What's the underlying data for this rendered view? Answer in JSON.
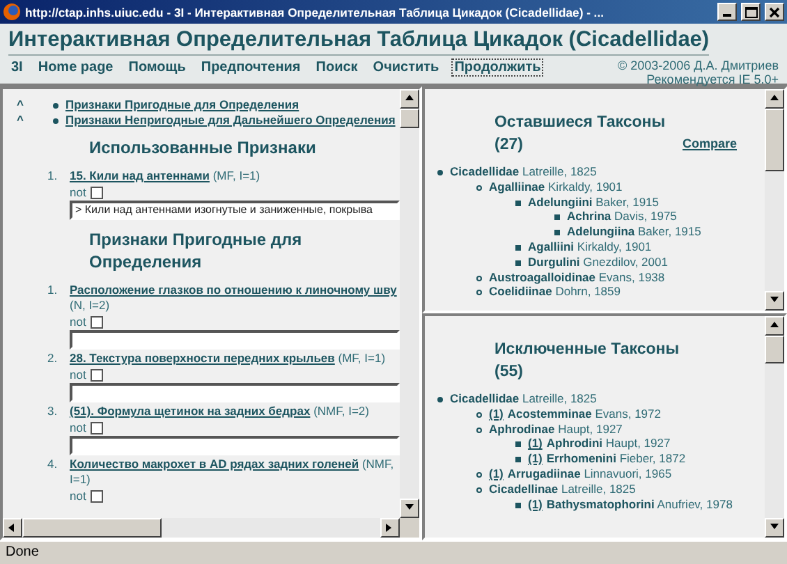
{
  "window": {
    "title": "http://ctap.inhs.uiuc.edu - 3I - Интерактивная Определительная Таблица Цикадок (Cicadellidae) - ..."
  },
  "header": {
    "title": "Интерактивная Определительная Таблица Цикадок (Cicadellidae)",
    "nav": [
      {
        "label": "3I",
        "selected": false
      },
      {
        "label": "Home page",
        "selected": false
      },
      {
        "label": "Помощь",
        "selected": false
      },
      {
        "label": "Предпочтения",
        "selected": false
      },
      {
        "label": "Поиск",
        "selected": false
      },
      {
        "label": "Очистить",
        "selected": false
      },
      {
        "label": "Продолжить",
        "selected": true
      }
    ],
    "copyright": "© 2003-2006 Д.А. Дмитриев",
    "recommendation": "Рекомендуется IE 5.0+"
  },
  "characters": {
    "jump_links": [
      {
        "marker": "^",
        "label": "Признаки Пригодные для Определения"
      },
      {
        "marker": "^",
        "label": "Признаки Непригодные для Дальнейшего Определения"
      }
    ],
    "used_heading": "Использованные Признаки",
    "used": [
      {
        "number": "1.",
        "label": "15. Кили над антеннами",
        "meta": "(MF, I=1)",
        "not_label": "not",
        "negated": false,
        "value": "> Кили над антеннами изогнутые и заниженные, покрыва"
      }
    ],
    "usable_heading": "Признаки Пригодные для Определения",
    "usable": [
      {
        "number": "1.",
        "label": "Расположение глазков по отношению к линочному шву",
        "meta": "(N, I=2)",
        "not_label": "not",
        "negated": false
      },
      {
        "number": "2.",
        "label": "28. Текстура поверхности передних крыльев",
        "meta": "(MF, I=1)",
        "not_label": "not",
        "negated": false
      },
      {
        "number": "3.",
        "label": "(51). Формула щетинок на задних бедрах",
        "meta": "(NMF, I=2)",
        "not_label": "not",
        "negated": false
      },
      {
        "number": "4.",
        "label": "Количество макрохет в AD рядах задних голеней",
        "meta": "(NMF, I=1)",
        "not_label": "not",
        "negated": false
      }
    ]
  },
  "remaining_taxa": {
    "heading": "Оставшиеся Таксоны (27)",
    "compare": "Compare",
    "tree": [
      {
        "name": "Cicadellidae",
        "author": "Latreille, 1825",
        "children": [
          {
            "name": "Agalliinae",
            "author": "Kirkaldy, 1901",
            "children": [
              {
                "name": "Adelungiini",
                "author": "Baker, 1915",
                "children": [
                  {
                    "name": "Achrina",
                    "author": "Davis, 1975"
                  },
                  {
                    "name": "Adelungiina",
                    "author": "Baker, 1915"
                  }
                ]
              },
              {
                "name": "Agalliini",
                "author": "Kirkaldy, 1901"
              },
              {
                "name": "Durgulini",
                "author": "Gnezdilov, 2001"
              }
            ]
          },
          {
            "name": "Austroagalloidinae",
            "author": "Evans, 1938"
          },
          {
            "name": "Coelidiinae",
            "author": "Dohrn, 1859"
          }
        ]
      }
    ]
  },
  "excluded_taxa": {
    "heading": "Исключенные Таксоны (55)",
    "tree": [
      {
        "name": "Cicadellidae",
        "author": "Latreille, 1825",
        "children": [
          {
            "count": "(1)",
            "name": "Acostemminae",
            "author": "Evans, 1972"
          },
          {
            "name": "Aphrodinae",
            "author": "Haupt, 1927",
            "children": [
              {
                "count": "(1)",
                "name": "Aphrodini",
                "author": "Haupt, 1927"
              },
              {
                "count": "(1)",
                "name": "Errhomenini",
                "author": "Fieber, 1872"
              }
            ]
          },
          {
            "count": "(1)",
            "name": "Arrugadiinae",
            "author": "Linnavuori, 1965"
          },
          {
            "name": "Cicadellinae",
            "author": "Latreille, 1825",
            "children": [
              {
                "count": "(1)",
                "name": "Bathysmatophorini",
                "author": "Anufriev, 1978"
              }
            ]
          }
        ]
      }
    ]
  },
  "status_bar": {
    "text": "Done"
  }
}
